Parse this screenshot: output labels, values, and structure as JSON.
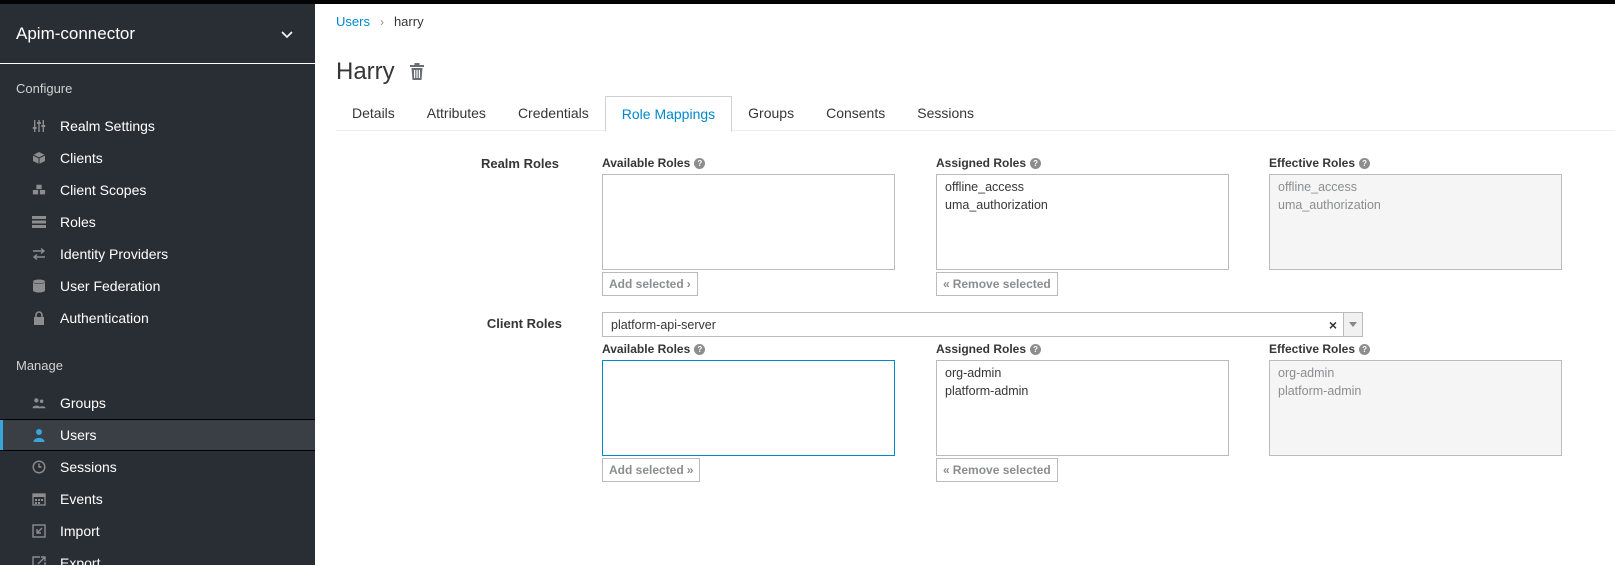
{
  "sidebar": {
    "realm_name": "Apim-connector",
    "configure_label": "Configure",
    "configure_items": [
      {
        "label": "Realm Settings",
        "icon": "sliders-icon"
      },
      {
        "label": "Clients",
        "icon": "cube-icon"
      },
      {
        "label": "Client Scopes",
        "icon": "cubes-icon"
      },
      {
        "label": "Roles",
        "icon": "list-icon"
      },
      {
        "label": "Identity Providers",
        "icon": "exchange-icon"
      },
      {
        "label": "User Federation",
        "icon": "database-icon"
      },
      {
        "label": "Authentication",
        "icon": "lock-icon"
      }
    ],
    "manage_label": "Manage",
    "manage_items": [
      {
        "label": "Groups",
        "icon": "users-icon"
      },
      {
        "label": "Users",
        "icon": "user-icon",
        "active": true
      },
      {
        "label": "Sessions",
        "icon": "clock-icon"
      },
      {
        "label": "Events",
        "icon": "calendar-icon"
      },
      {
        "label": "Import",
        "icon": "import-icon"
      },
      {
        "label": "Export",
        "icon": "export-icon"
      }
    ]
  },
  "breadcrumb": {
    "parent": "Users",
    "current": "harry"
  },
  "page_title": "Harry",
  "tabs": [
    {
      "label": "Details"
    },
    {
      "label": "Attributes"
    },
    {
      "label": "Credentials"
    },
    {
      "label": "Role Mappings",
      "active": true
    },
    {
      "label": "Groups"
    },
    {
      "label": "Consents"
    },
    {
      "label": "Sessions"
    }
  ],
  "realm_roles": {
    "label": "Realm Roles",
    "available_label": "Available Roles",
    "assigned_label": "Assigned Roles",
    "effective_label": "Effective Roles",
    "available": [],
    "assigned": [
      "offline_access",
      "uma_authorization"
    ],
    "effective": [
      "offline_access",
      "uma_authorization"
    ],
    "add_button": "Add selected",
    "remove_button": "Remove selected"
  },
  "client_roles": {
    "label": "Client Roles",
    "selected_client": "platform-api-server",
    "clear_symbol": "×",
    "available_label": "Available Roles",
    "assigned_label": "Assigned Roles",
    "effective_label": "Effective Roles",
    "available": [],
    "assigned": [
      "org-admin",
      "platform-admin"
    ],
    "effective": [
      "org-admin",
      "platform-admin"
    ],
    "add_button": "Add selected",
    "remove_button": "Remove selected"
  },
  "colors": {
    "sidebar_bg": "#292e34",
    "link": "#0088ce",
    "active_accent": "#39a5dc"
  }
}
